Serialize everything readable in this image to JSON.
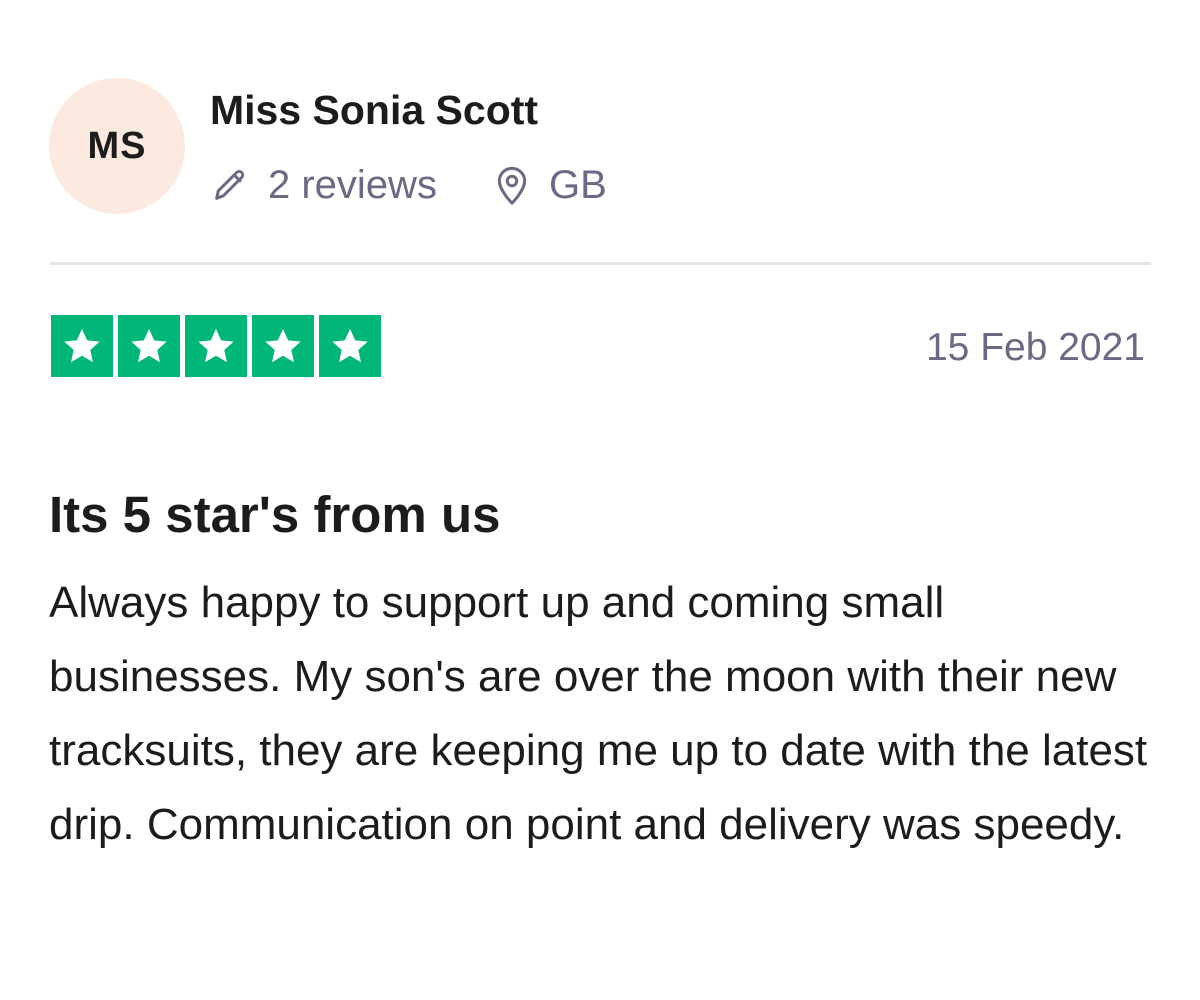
{
  "reviewer": {
    "initials": "MS",
    "name": "Miss Sonia Scott",
    "reviews_count": "2 reviews",
    "country": "GB",
    "avatar_color": "#fce9df"
  },
  "rating": {
    "stars": 5,
    "max_stars": 5,
    "color": "#00b67a"
  },
  "review": {
    "date": "15 Feb 2021",
    "title": "Its 5 star's from us",
    "body": "Always happy to support up and coming small businesses. My son's are over the moon with their new tracksuits, they are keeping me up to date with the latest drip. Communication on point and delivery was speedy."
  },
  "icons": {
    "reviews": "pencil-icon",
    "location": "location-pin-icon",
    "rating_star": "star-icon"
  }
}
